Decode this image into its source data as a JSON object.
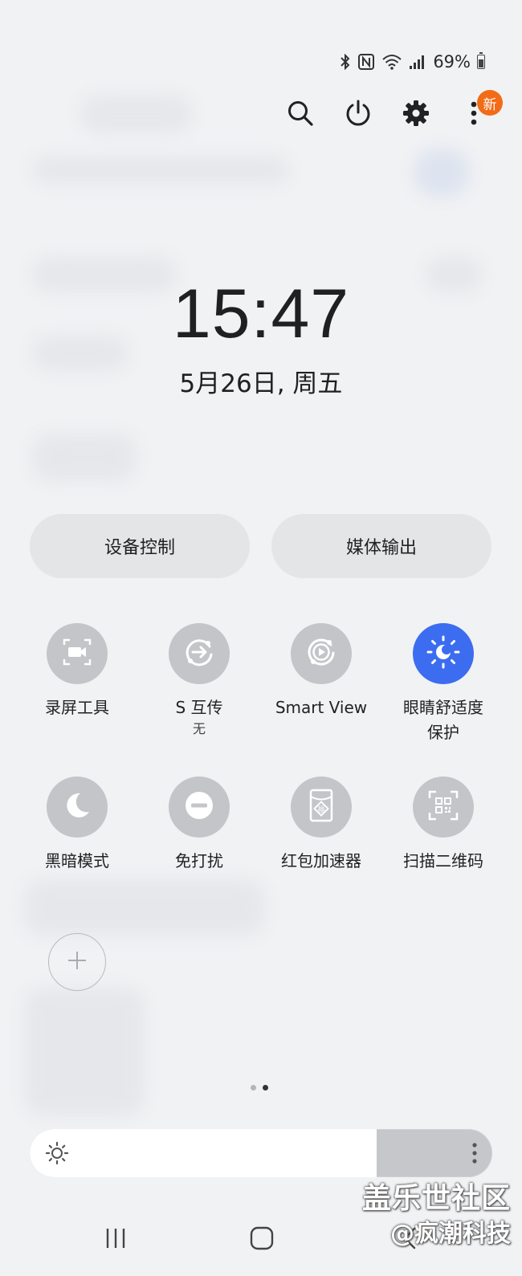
{
  "status_bar": {
    "battery_text": "69%",
    "battery_level": 0.69,
    "icons": [
      "bluetooth-icon",
      "nfc-icon",
      "wifi-icon",
      "signal-icon",
      "battery-icon"
    ]
  },
  "top_actions": {
    "icons": [
      "search-icon",
      "power-icon",
      "gear-icon",
      "more-vertical-icon"
    ],
    "new_badge": "新"
  },
  "clock": {
    "time": "15:47",
    "date": "5月26日, 周五"
  },
  "pills": {
    "device_control": "设备控制",
    "media_output": "媒体输出"
  },
  "tiles": [
    {
      "label": "录屏工具",
      "sub": "",
      "icon": "screen-record-icon",
      "active": false
    },
    {
      "label": "S 互传",
      "sub": "无",
      "icon": "quick-share-icon",
      "active": false
    },
    {
      "label": "Smart View",
      "sub": "",
      "icon": "smart-view-icon",
      "active": false
    },
    {
      "label": "眼睛舒适度\n保护",
      "sub": "",
      "icon": "eye-comfort-icon",
      "active": true
    },
    {
      "label": "黑暗模式",
      "sub": "",
      "icon": "moon-icon",
      "active": false
    },
    {
      "label": "免打扰",
      "sub": "",
      "icon": "do-not-disturb-icon",
      "active": false
    },
    {
      "label": "红包加速器",
      "sub": "",
      "icon": "red-packet-icon",
      "active": false
    },
    {
      "label": "扫描二维码",
      "sub": "",
      "icon": "qr-scan-icon",
      "active": false
    }
  ],
  "pager": {
    "count": 2,
    "active": 1
  },
  "brightness": {
    "level": 0.75
  },
  "watermark": {
    "line1": "盖乐世社区",
    "line2": "@疯潮科技"
  },
  "colors": {
    "background": "#f1f2f4",
    "tile_off": "#c4c5c8",
    "tile_on": "#3c6df0",
    "badge": "#f26b16"
  }
}
